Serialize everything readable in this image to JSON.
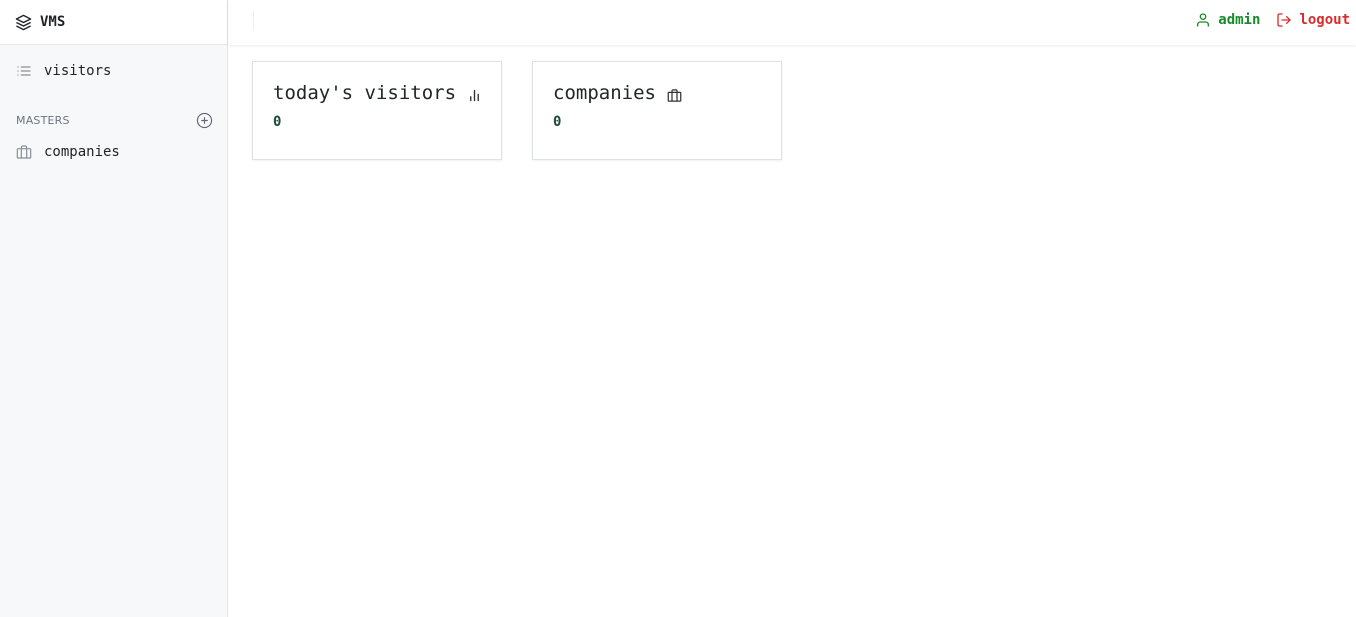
{
  "brand": {
    "name": "VMS",
    "icon": "layers-icon"
  },
  "sidebar": {
    "items": [
      {
        "label": "visitors",
        "icon": "list-icon"
      }
    ],
    "sections": [
      {
        "title": "MASTERS",
        "action_icon": "plus-circle-icon",
        "items": [
          {
            "label": "companies",
            "icon": "briefcase-icon"
          }
        ]
      }
    ]
  },
  "header": {
    "user": {
      "label": "admin",
      "icon": "user-icon",
      "color": "#198a2a"
    },
    "logout": {
      "label": "logout",
      "icon": "logout-icon",
      "color": "#dc2b2b"
    }
  },
  "dashboard": {
    "cards": [
      {
        "title": "today's visitors",
        "icon": "bar-chart-icon",
        "value": "0"
      },
      {
        "title": "companies",
        "icon": "briefcase-icon",
        "value": "0"
      }
    ]
  }
}
